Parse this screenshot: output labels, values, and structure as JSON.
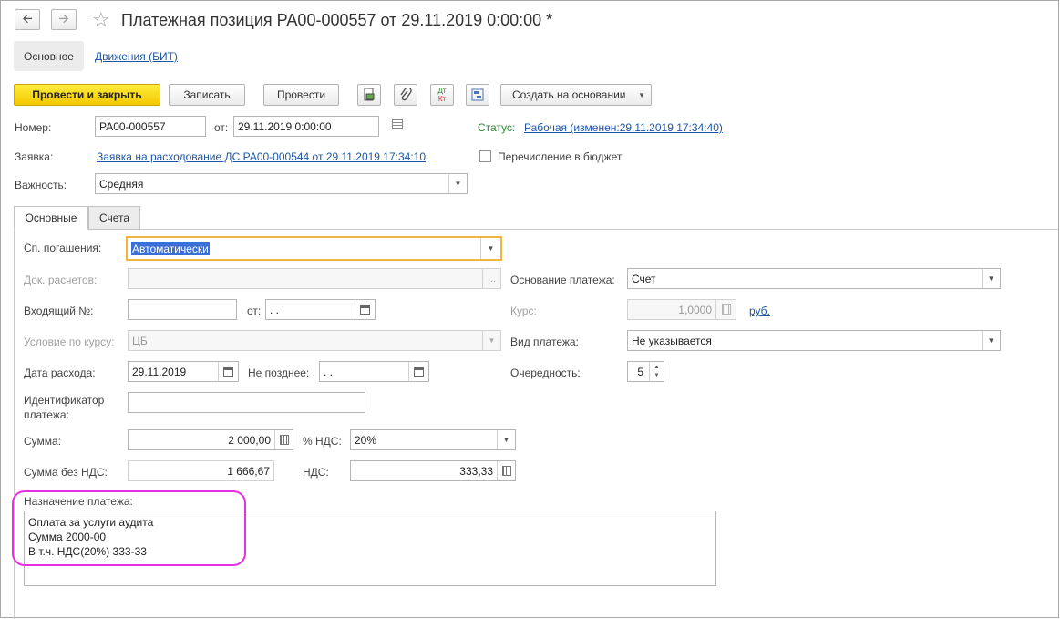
{
  "window": {
    "back_icon": "arrow-left-icon",
    "forward_icon": "arrow-right-icon",
    "favorite_icon": "star-icon",
    "title": "Платежная позиция РА00-000557 от 29.11.2019 0:00:00 *"
  },
  "sections": {
    "main": "Основное",
    "movements": "Движения (БИТ)"
  },
  "toolbar": {
    "post_close": "Провести и закрыть",
    "save": "Записать",
    "post": "Провести",
    "dtkt_label": "Дт\nКт",
    "create_based": "Создать на основании"
  },
  "header": {
    "number_label": "Номер:",
    "number_value": "РА00-000557",
    "date_label": "от:",
    "date_value": "29.11.2019  0:00:00",
    "status_label": "Статус:",
    "status_value": "Рабочая (изменен:29.11.2019 17:34:40)",
    "request_label": "Заявка:",
    "request_value": "Заявка на расходование ДС РА00-000544 от 29.11.2019 17:34:10",
    "budget_label": "Перечисление в бюджет",
    "importance_label": "Важность:",
    "importance_value": "Средняя"
  },
  "tabs": [
    {
      "label": "Основные",
      "active": true
    },
    {
      "label": "Счета",
      "active": false
    }
  ],
  "form": {
    "repayment_label": "Сп. погашения:",
    "repayment_value": "Автоматически",
    "doc_label": "Док. расчетов:",
    "doc_value": "",
    "doc_btn": "...",
    "basis_label": "Основание платежа:",
    "basis_value": "Счет",
    "incoming_label": "Входящий №:",
    "incoming_value": "",
    "incoming_date_label": "от:",
    "incoming_date_value": " .  .",
    "rate_label": "Курс:",
    "rate_value": "1,0000",
    "currency": "руб.",
    "rate_cond_label": "Условие по курсу:",
    "rate_cond_value": "ЦБ",
    "payment_type_label": "Вид платежа:",
    "payment_type_value": "Не указывается",
    "expense_date_label": "Дата расхода:",
    "expense_date_value": "29.11.2019",
    "not_later_label": "Не позднее:",
    "not_later_value": " .  .",
    "priority_label": "Очередность:",
    "priority_value": "5",
    "payment_id_label_1": "Идентификатор",
    "payment_id_label_2": "платежа:",
    "payment_id_value": "",
    "sum_label": "Сумма:",
    "sum_value": "2 000,00",
    "vat_rate_label": "% НДС:",
    "vat_rate_value": "20%",
    "sum_novat_label": "Сумма без НДС:",
    "sum_novat_value": "1 666,67",
    "vat_label": "НДС:",
    "vat_value": "333,33",
    "purpose_label": "Назначение платежа:",
    "purpose_lines": [
      "Оплата за услуги аудита",
      "Сумма 2000-00",
      "В т.ч. НДС(20%) 333-33"
    ]
  },
  "colors": {
    "primary_button": "#f3c800",
    "link": "#1d56a7",
    "status_label": "#2c8a2c",
    "focus_border": "#f2b640",
    "highlight": "#e72ee0",
    "selection": "#3a6fd8"
  }
}
